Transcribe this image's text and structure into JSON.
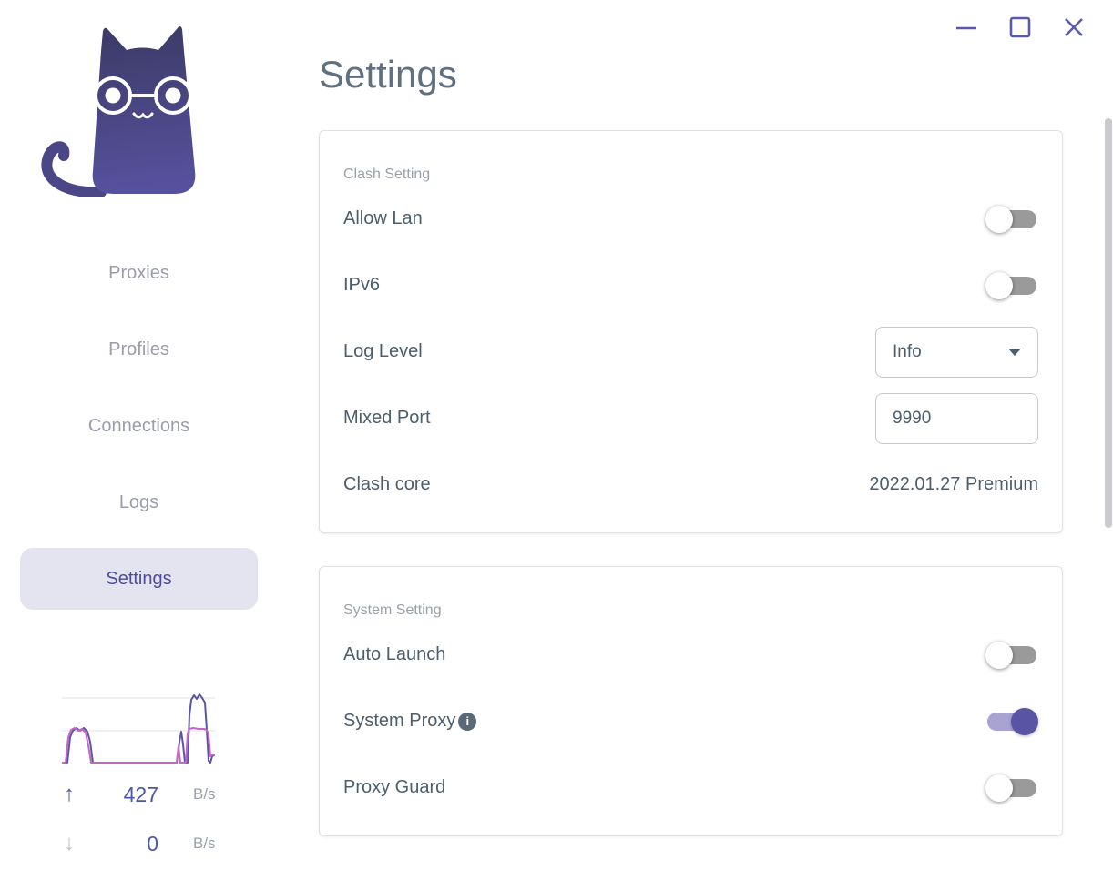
{
  "window_controls": {
    "minimize": "minimize",
    "maximize": "maximize",
    "close": "close"
  },
  "sidebar": {
    "logo_icon": "clash-cat-logo",
    "nav": [
      {
        "label": "Proxies",
        "active": false
      },
      {
        "label": "Profiles",
        "active": false
      },
      {
        "label": "Connections",
        "active": false
      },
      {
        "label": "Logs",
        "active": false
      },
      {
        "label": "Settings",
        "active": true
      }
    ],
    "traffic": {
      "up": {
        "icon": "up-arrow",
        "value": "427",
        "unit": "B/s"
      },
      "down": {
        "icon": "down-arrow",
        "value": "0",
        "unit": "B/s"
      },
      "chart": {
        "type": "line",
        "width": 168,
        "height": 82,
        "grid_y": [
          9,
          45
        ],
        "series": [
          {
            "name": "upload",
            "color": "#5b55a5",
            "points": [
              [
                0,
                80
              ],
              [
                6,
                80
              ],
              [
                9,
                52
              ],
              [
                12,
                45
              ],
              [
                16,
                42
              ],
              [
                20,
                45
              ],
              [
                24,
                42
              ],
              [
                28,
                46
              ],
              [
                31,
                57
              ],
              [
                34,
                80
              ],
              [
                126,
                80
              ],
              [
                129,
                57
              ],
              [
                131,
                46
              ],
              [
                133,
                60
              ],
              [
                135,
                80
              ],
              [
                138,
                80
              ],
              [
                140,
                28
              ],
              [
                142,
                11
              ],
              [
                145,
                6
              ],
              [
                148,
                10
              ],
              [
                151,
                5
              ],
              [
                154,
                9
              ],
              [
                157,
                14
              ],
              [
                159,
                44
              ],
              [
                161,
                78
              ],
              [
                163,
                80
              ],
              [
                165,
                73
              ],
              [
                168,
                71
              ]
            ]
          },
          {
            "name": "download",
            "color": "#c565c9",
            "points": [
              [
                0,
                80
              ],
              [
                4,
                80
              ],
              [
                7,
                52
              ],
              [
                10,
                44
              ],
              [
                14,
                42
              ],
              [
                18,
                45
              ],
              [
                22,
                43
              ],
              [
                26,
                47
              ],
              [
                29,
                61
              ],
              [
                32,
                80
              ],
              [
                126,
                80
              ],
              [
                128,
                62
              ],
              [
                130,
                80
              ],
              [
                136,
                80
              ],
              [
                138,
                48
              ],
              [
                140,
                43
              ],
              [
                144,
                42
              ],
              [
                150,
                43
              ],
              [
                156,
                43
              ],
              [
                159,
                44
              ],
              [
                161,
                49
              ],
              [
                163,
                73
              ],
              [
                166,
                71
              ],
              [
                168,
                72
              ]
            ]
          }
        ]
      }
    }
  },
  "main": {
    "title": "Settings",
    "cards": [
      {
        "header": "Clash Setting",
        "rows": [
          {
            "label": "Allow Lan",
            "control": "toggle",
            "state": "off"
          },
          {
            "label": "IPv6",
            "control": "toggle",
            "state": "off"
          },
          {
            "label": "Log Level",
            "control": "select",
            "value": "Info"
          },
          {
            "label": "Mixed Port",
            "control": "input",
            "value": "9990"
          },
          {
            "label": "Clash core",
            "control": "text",
            "value": "2022.01.27 Premium"
          }
        ]
      },
      {
        "header": "System Setting",
        "rows": [
          {
            "label": "Auto Launch",
            "control": "toggle",
            "state": "off"
          },
          {
            "label": "System Proxy",
            "control": "toggle",
            "state": "on",
            "info_icon": true
          },
          {
            "label": "Proxy Guard",
            "control": "toggle",
            "state": "off"
          }
        ]
      }
    ]
  },
  "colors": {
    "accent": "#5a54a4",
    "accent_light": "#a9a3d2",
    "toggle_off_track": "#9a9a9a",
    "nav_active_bg": "#e4e4f1",
    "nav_active_text": "#4c4c9d",
    "nav_text": "#9b9cab",
    "title_text": "#607080",
    "label_text": "#4c5d6c",
    "muted_text": "#9aa0a8",
    "window_button": "#5a5aad",
    "gridline": "#ececec",
    "upload_line": "#5b55a5",
    "download_line": "#c565c9"
  }
}
